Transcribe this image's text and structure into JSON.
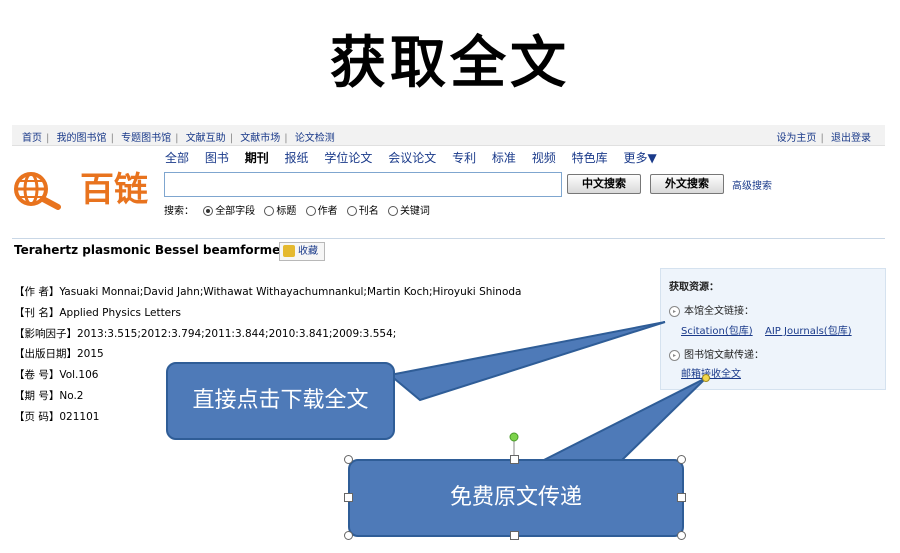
{
  "slide_title": "获取全文",
  "topnav": {
    "links": [
      "首页",
      "我的图书馆",
      "专题图书馆",
      "文献互助",
      "文献市场",
      "论文检测"
    ],
    "right_links": [
      "设为主页",
      "退出登录"
    ]
  },
  "logo": {
    "text": "百链",
    "icon": "globe-magnifier-icon"
  },
  "categories": [
    {
      "label": "全部",
      "active": false
    },
    {
      "label": "图书",
      "active": false
    },
    {
      "label": "期刊",
      "active": true
    },
    {
      "label": "报纸",
      "active": false
    },
    {
      "label": "学位论文",
      "active": false
    },
    {
      "label": "会议论文",
      "active": false
    },
    {
      "label": "专利",
      "active": false
    },
    {
      "label": "标准",
      "active": false
    },
    {
      "label": "视频",
      "active": false
    },
    {
      "label": "特色库",
      "active": false
    },
    {
      "label": "更多▼",
      "active": false
    }
  ],
  "search": {
    "value": "",
    "btn_cn": "中文搜索",
    "btn_foreign": "外文搜索",
    "advanced": "高级搜索",
    "scope_label": "搜索：",
    "scope_options": [
      {
        "label": "全部字段",
        "selected": true
      },
      {
        "label": "标题",
        "selected": false
      },
      {
        "label": "作者",
        "selected": false
      },
      {
        "label": "刊名",
        "selected": false
      },
      {
        "label": "关键词",
        "selected": false
      }
    ]
  },
  "article": {
    "title": "Terahertz plasmonic Bessel beamformer",
    "fav_label": "收藏",
    "fields": [
      {
        "label": "【作 者】",
        "value": "Yasuaki Monnai;David Jahn;Withawat Withayachumnankul;Martin Koch;Hiroyuki Shinoda"
      },
      {
        "label": "【刊 名】",
        "value": "Applied Physics Letters"
      },
      {
        "label": "【影响因子】",
        "value": "2013:3.515;2012:3.794;2011:3.844;2010:3.841;2009:3.554;"
      },
      {
        "label": "【出版日期】",
        "value": "2015"
      },
      {
        "label": "【卷 号】",
        "value": "Vol.106"
      },
      {
        "label": "【期 号】",
        "value": "No.2"
      },
      {
        "label": "【页 码】",
        "value": "021101"
      }
    ]
  },
  "resources": {
    "heading": "获取资源：",
    "local_label": "本馆全文链接：",
    "local_links": [
      "Scitation(包库)",
      "AIP Journals(包库)"
    ],
    "delivery_label": "图书馆文献传递：",
    "delivery_link": "邮箱接收全文"
  },
  "callouts": {
    "direct": "直接点击下载全文",
    "free": "免费原文传递"
  },
  "colors": {
    "callout_fill": "#4e7ab8",
    "callout_border": "#2f5d97",
    "link": "#1a3a8a",
    "logo": "#e8731e"
  }
}
